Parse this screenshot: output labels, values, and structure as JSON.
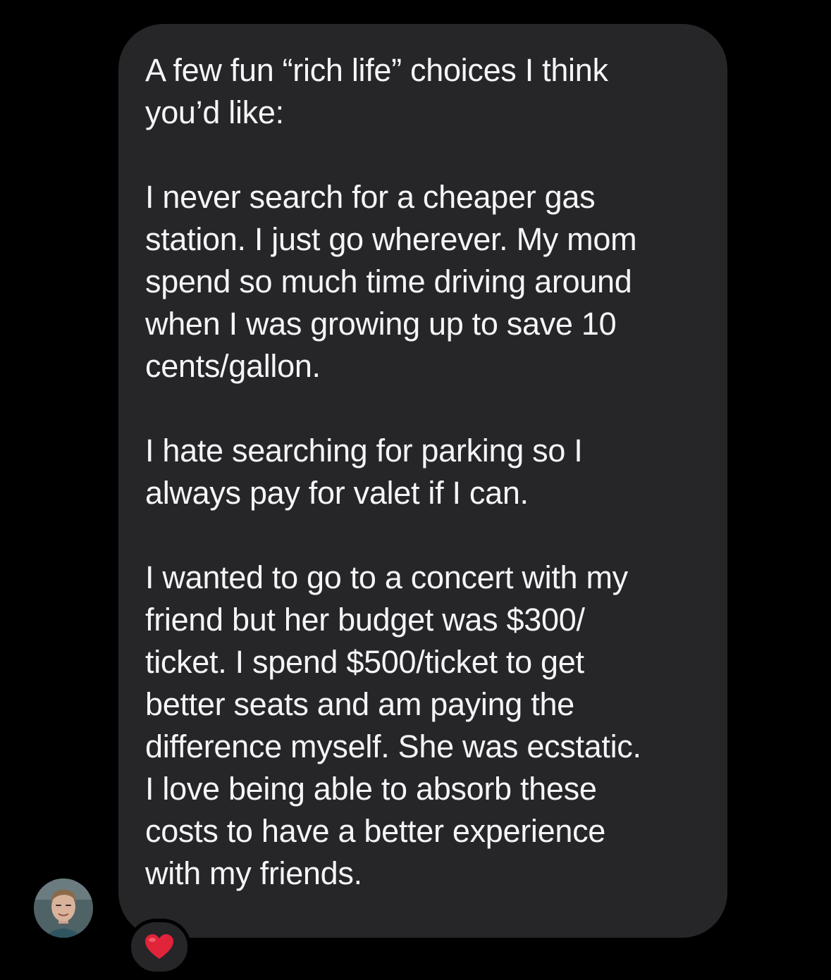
{
  "message": {
    "paragraphs": [
      "A few fun “rich life” choices I think\nyou’d like:",
      "I never search for a cheaper gas\nstation. I just go wherever. My mom\nspend so much time driving around\nwhen I was growing up to save 10\ncents/gallon.",
      "I hate searching for parking so I\nalways pay for valet if I can.",
      "I wanted to go to a concert with my\nfriend but her budget was $300/\nticket. I spend $500/ticket to get\nbetter seats and am paying the\ndifference myself. She was ecstatic.\nI love being able to absorb these\ncosts to have a better experience\nwith my friends."
    ],
    "reaction": "heart-icon",
    "sender_avatar": "avatar"
  },
  "colors": {
    "background": "#000000",
    "bubble": "#262628",
    "text": "#f5f5f7",
    "heart": "#e0243a"
  }
}
